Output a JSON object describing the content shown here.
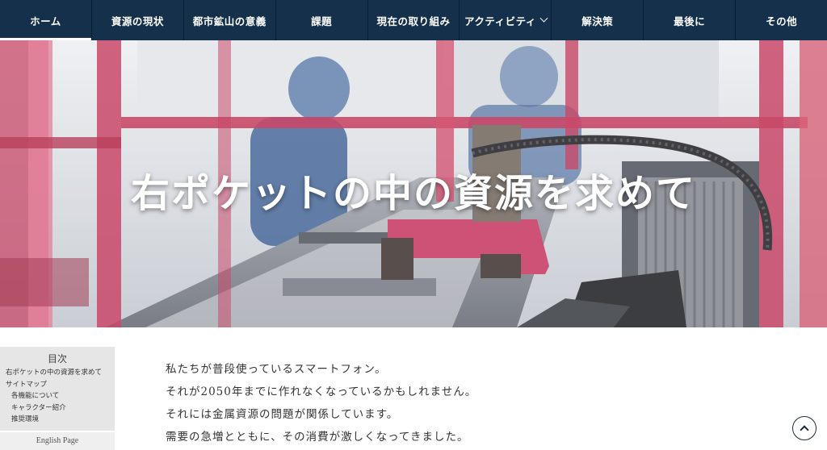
{
  "nav": {
    "items": [
      {
        "label": "ホーム"
      },
      {
        "label": "資源の現状"
      },
      {
        "label": "都市鉱山の意義"
      },
      {
        "label": "課題"
      },
      {
        "label": "現在の取り組み"
      },
      {
        "label": "アクティビティ"
      },
      {
        "label": "解決策"
      },
      {
        "label": "最後に"
      },
      {
        "label": "その他"
      }
    ],
    "active_index": 0,
    "dropdown_icon": "chevron-down-icon"
  },
  "hero": {
    "title": "右ポケットの中の資源を求めて"
  },
  "toc": {
    "heading": "目次",
    "links": [
      {
        "label": "右ポケットの中の資源を求めて"
      },
      {
        "label": "サイトマップ"
      },
      {
        "label": "各機能について"
      },
      {
        "label": "キャラクター紹介"
      },
      {
        "label": "推奨環境"
      }
    ],
    "english_link": "English Page"
  },
  "content": {
    "paragraphs": [
      "私たちが普段使っているスマートフォン。",
      "それが2050年までに作れなくなっているかもしれません。",
      "それには金属資源の問題が関係しています。",
      "需要の急増とともに、その消費が激しくなってきました。"
    ]
  },
  "back_to_top": {
    "icon": "chevron-up-icon"
  },
  "colors": {
    "nav_bg": "#14304a",
    "hero_accent": "#c43a5c"
  }
}
